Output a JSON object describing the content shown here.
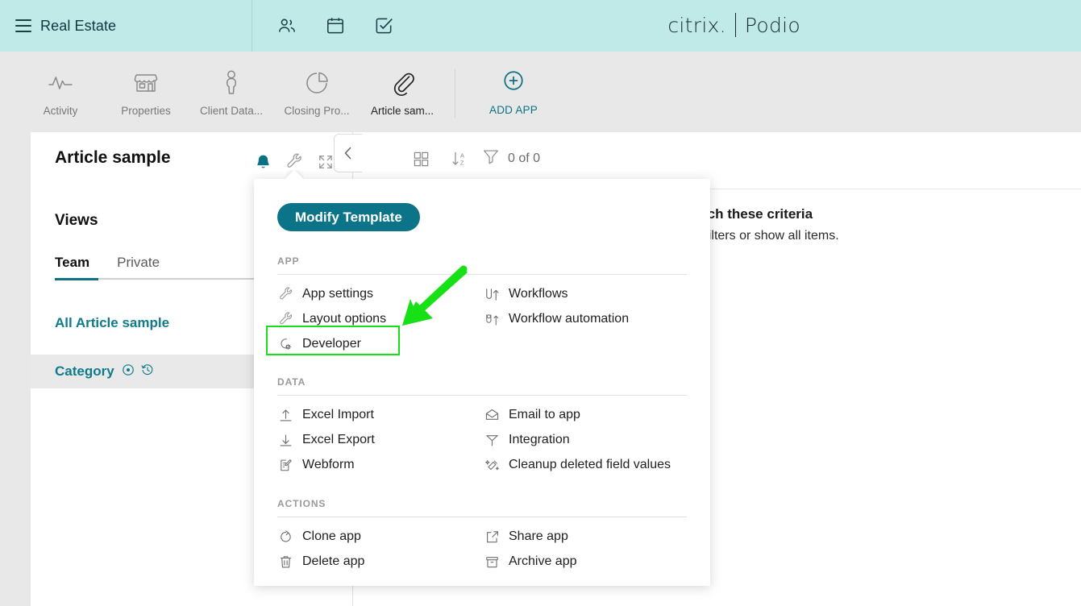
{
  "header": {
    "menu_icon": "hamburger-icon",
    "org_title": "Real Estate",
    "icons": [
      {
        "name": "contacts-icon",
        "label": "Contacts"
      },
      {
        "name": "calendar-icon",
        "label": "Calendar"
      },
      {
        "name": "tasks-icon",
        "label": "Tasks"
      }
    ],
    "brand": {
      "citrix": "citrix.",
      "podio": "Podio"
    }
  },
  "appnav": {
    "items": [
      {
        "label": "Activity",
        "icon": "activity-pulse-icon",
        "active": false
      },
      {
        "label": "Properties",
        "icon": "storefront-icon",
        "active": false
      },
      {
        "label": "Client Data...",
        "icon": "person-icon",
        "active": false
      },
      {
        "label": "Closing Pro...",
        "icon": "pie-chart-icon",
        "active": false
      },
      {
        "label": "Article sam...",
        "icon": "paperclip-icon",
        "active": true
      }
    ],
    "add_app": {
      "label": "ADD APP",
      "icon": "plus-circle-icon",
      "color": "#0b7285"
    }
  },
  "left_pane": {
    "title": "Article sample",
    "title_icons": [
      {
        "name": "bell-icon",
        "label": "Notifications"
      },
      {
        "name": "wrench-icon",
        "label": "App menu"
      },
      {
        "name": "expand-icon",
        "label": "Fullscreen"
      }
    ],
    "views_heading": "Views",
    "tabs": [
      {
        "label": "Team",
        "active": true
      },
      {
        "label": "Private",
        "active": false
      }
    ],
    "view_items": [
      {
        "label": "All Article sample",
        "selected": false,
        "icons": []
      },
      {
        "label": "Category",
        "selected": true,
        "icons": [
          "circle-dot-icon",
          "history-icon"
        ]
      }
    ]
  },
  "toolbar": {
    "collapse_icon": "chevron-left-icon",
    "icons": [
      {
        "name": "grid-view-icon",
        "label": "Grid view"
      },
      {
        "name": "sort-az-icon",
        "label": "Sort A-Z"
      }
    ],
    "filter": {
      "icon": "filter-funnel-icon",
      "count_label": "0 of 0"
    }
  },
  "empty_state": {
    "title": "No items match these criteria",
    "subtitle": "Please adjust your filters or show all items."
  },
  "menu": {
    "modify_template_label": "Modify Template",
    "sections": [
      {
        "heading": "APP",
        "items": [
          {
            "label": "App settings",
            "icon": "wrench-icon",
            "column": "left"
          },
          {
            "label": "Workflows",
            "icon": "workflows-icon",
            "column": "right"
          },
          {
            "label": "Layout options",
            "icon": "wrench-icon",
            "column": "left"
          },
          {
            "label": "Workflow automation",
            "icon": "workflow-automation-icon",
            "column": "right"
          },
          {
            "label": "Developer",
            "icon": "developer-gear-icon",
            "column": "left",
            "highlighted": true
          },
          {
            "label": "",
            "icon": "",
            "column": "right"
          }
        ]
      },
      {
        "heading": "DATA",
        "items": [
          {
            "label": "Excel Import",
            "icon": "upload-icon",
            "column": "left"
          },
          {
            "label": "Email to app",
            "icon": "envelope-icon",
            "column": "right"
          },
          {
            "label": "Excel Export",
            "icon": "download-icon",
            "column": "left"
          },
          {
            "label": "Integration",
            "icon": "integration-icon",
            "column": "right"
          },
          {
            "label": "Webform",
            "icon": "webform-icon",
            "column": "left"
          },
          {
            "label": "Cleanup deleted field values",
            "icon": "cleanup-icon",
            "column": "right"
          }
        ]
      },
      {
        "heading": "ACTIONS",
        "items": [
          {
            "label": "Clone app",
            "icon": "clone-icon",
            "column": "left"
          },
          {
            "label": "Share app",
            "icon": "share-icon",
            "column": "right"
          },
          {
            "label": "Delete app",
            "icon": "trash-icon",
            "column": "left"
          },
          {
            "label": "Archive app",
            "icon": "archive-icon",
            "column": "right"
          }
        ]
      }
    ]
  },
  "annotation": {
    "highlight_color": "#17e017",
    "arrow_color": "#17e017",
    "target": "Developer"
  },
  "colors": {
    "header_bg": "#bfeae8",
    "nav_bg": "#e8e8e8",
    "accent_teal": "#0b7285",
    "button_teal": "#0c7489",
    "link_teal": "#0f7b8a"
  }
}
